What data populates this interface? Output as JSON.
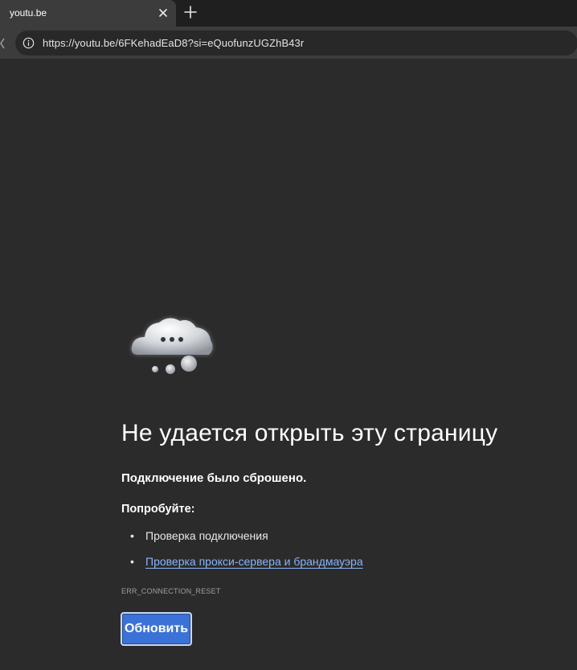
{
  "browser": {
    "tab": {
      "title": "youtu.be"
    },
    "address_bar": {
      "url": "https://youtu.be/6FKehadEaD8?si=eQuofunzUGZhB43r"
    }
  },
  "error_page": {
    "headline": "Не удается открыть эту страницу",
    "subtitle": "Подключение было сброшено.",
    "try_label": "Попробуйте:",
    "suggestions": [
      {
        "text": "Проверка подключения",
        "is_link": false
      },
      {
        "text": "Проверка прокси-сервера и брандмауэра",
        "is_link": true
      }
    ],
    "error_code": "ERR_CONNECTION_RESET",
    "reload_button": "Обновить",
    "illustration_icon": "cloud-thinking-icon"
  }
}
